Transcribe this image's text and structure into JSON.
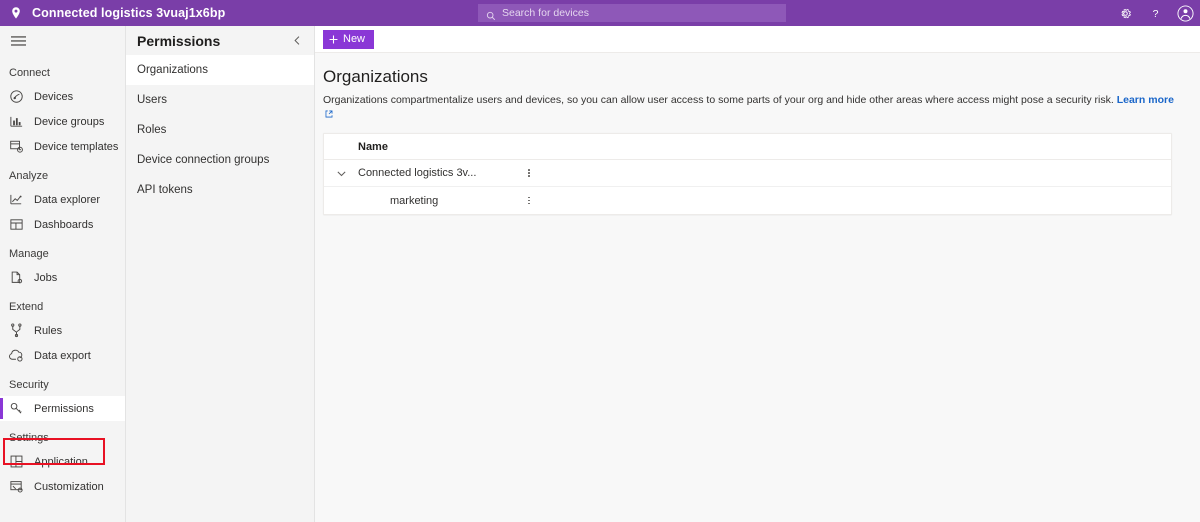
{
  "topbar": {
    "pin_icon": "location-pin-icon",
    "app_title": "Connected logistics 3vuaj1x6bp",
    "search": {
      "icon": "search-icon",
      "placeholder": "Search for devices",
      "value": ""
    },
    "actions": [
      {
        "name": "settings-gear-icon",
        "label": "Settings"
      },
      {
        "name": "help-question-icon",
        "label": "Help"
      },
      {
        "name": "account-avatar-icon",
        "label": "Account"
      }
    ],
    "bg_color": "#7A3EA8"
  },
  "leftnav": {
    "menu_icon": "hamburger-menu-icon",
    "groups": [
      {
        "title": "Connect",
        "items": [
          {
            "label": "Devices",
            "icon": "devices-icon",
            "selected": false
          },
          {
            "label": "Device groups",
            "icon": "device-groups-icon",
            "selected": false
          },
          {
            "label": "Device templates",
            "icon": "device-templates-icon",
            "selected": false
          }
        ]
      },
      {
        "title": "Analyze",
        "items": [
          {
            "label": "Data explorer",
            "icon": "data-explorer-icon",
            "selected": false
          },
          {
            "label": "Dashboards",
            "icon": "dashboards-icon",
            "selected": false
          }
        ]
      },
      {
        "title": "Manage",
        "items": [
          {
            "label": "Jobs",
            "icon": "jobs-icon",
            "selected": false
          }
        ]
      },
      {
        "title": "Extend",
        "items": [
          {
            "label": "Rules",
            "icon": "rules-icon",
            "selected": false
          },
          {
            "label": "Data export",
            "icon": "data-export-icon",
            "selected": false
          }
        ]
      },
      {
        "title": "Security",
        "items": [
          {
            "label": "Permissions",
            "icon": "permissions-key-icon",
            "selected": true
          }
        ]
      },
      {
        "title": "Settings",
        "items": [
          {
            "label": "Application",
            "icon": "application-icon",
            "selected": false
          },
          {
            "label": "Customization",
            "icon": "customization-icon",
            "selected": false
          }
        ]
      }
    ],
    "highlight_color": "#E81123",
    "accent_color": "#8A37D6"
  },
  "subnav": {
    "title": "Permissions",
    "collapse_icon": "chevron-left-icon",
    "items": [
      {
        "label": "Organizations",
        "selected": true
      },
      {
        "label": "Users",
        "selected": false
      },
      {
        "label": "Roles",
        "selected": false
      },
      {
        "label": "Device connection groups",
        "selected": false
      },
      {
        "label": "API tokens",
        "selected": false
      }
    ]
  },
  "main": {
    "commandbar": {
      "new_button": {
        "label": "New",
        "icon": "plus-icon",
        "color": "#8A37D6"
      }
    },
    "page_title": "Organizations",
    "description": "Organizations compartmentalize users and devices, so you can allow user access to some parts of your org and hide other areas where access might pose a security risk.",
    "learn_more": {
      "label": "Learn more",
      "icon": "external-link-icon",
      "color": "#1A66C9"
    },
    "table": {
      "columns": [
        "Name"
      ],
      "rows": [
        {
          "name": "Connected logistics 3v...",
          "level": 0,
          "expanded": true,
          "chevron": "chevron-down-icon",
          "menu": "more-options-icon"
        },
        {
          "name": "marketing",
          "level": 1,
          "expanded": false,
          "chevron": "",
          "menu": "more-options-icon"
        }
      ]
    }
  }
}
